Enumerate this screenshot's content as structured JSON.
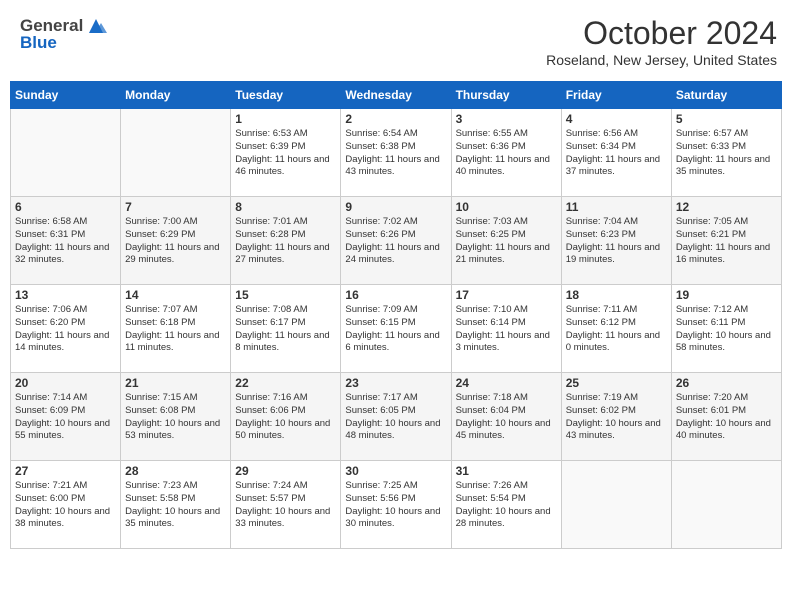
{
  "header": {
    "logo_general": "General",
    "logo_blue": "Blue",
    "month": "October 2024",
    "location": "Roseland, New Jersey, United States"
  },
  "days_of_week": [
    "Sunday",
    "Monday",
    "Tuesday",
    "Wednesday",
    "Thursday",
    "Friday",
    "Saturday"
  ],
  "weeks": [
    [
      {
        "day": "",
        "sunrise": "",
        "sunset": "",
        "daylight": ""
      },
      {
        "day": "",
        "sunrise": "",
        "sunset": "",
        "daylight": ""
      },
      {
        "day": "1",
        "sunrise": "Sunrise: 6:53 AM",
        "sunset": "Sunset: 6:39 PM",
        "daylight": "Daylight: 11 hours and 46 minutes."
      },
      {
        "day": "2",
        "sunrise": "Sunrise: 6:54 AM",
        "sunset": "Sunset: 6:38 PM",
        "daylight": "Daylight: 11 hours and 43 minutes."
      },
      {
        "day": "3",
        "sunrise": "Sunrise: 6:55 AM",
        "sunset": "Sunset: 6:36 PM",
        "daylight": "Daylight: 11 hours and 40 minutes."
      },
      {
        "day": "4",
        "sunrise": "Sunrise: 6:56 AM",
        "sunset": "Sunset: 6:34 PM",
        "daylight": "Daylight: 11 hours and 37 minutes."
      },
      {
        "day": "5",
        "sunrise": "Sunrise: 6:57 AM",
        "sunset": "Sunset: 6:33 PM",
        "daylight": "Daylight: 11 hours and 35 minutes."
      }
    ],
    [
      {
        "day": "6",
        "sunrise": "Sunrise: 6:58 AM",
        "sunset": "Sunset: 6:31 PM",
        "daylight": "Daylight: 11 hours and 32 minutes."
      },
      {
        "day": "7",
        "sunrise": "Sunrise: 7:00 AM",
        "sunset": "Sunset: 6:29 PM",
        "daylight": "Daylight: 11 hours and 29 minutes."
      },
      {
        "day": "8",
        "sunrise": "Sunrise: 7:01 AM",
        "sunset": "Sunset: 6:28 PM",
        "daylight": "Daylight: 11 hours and 27 minutes."
      },
      {
        "day": "9",
        "sunrise": "Sunrise: 7:02 AM",
        "sunset": "Sunset: 6:26 PM",
        "daylight": "Daylight: 11 hours and 24 minutes."
      },
      {
        "day": "10",
        "sunrise": "Sunrise: 7:03 AM",
        "sunset": "Sunset: 6:25 PM",
        "daylight": "Daylight: 11 hours and 21 minutes."
      },
      {
        "day": "11",
        "sunrise": "Sunrise: 7:04 AM",
        "sunset": "Sunset: 6:23 PM",
        "daylight": "Daylight: 11 hours and 19 minutes."
      },
      {
        "day": "12",
        "sunrise": "Sunrise: 7:05 AM",
        "sunset": "Sunset: 6:21 PM",
        "daylight": "Daylight: 11 hours and 16 minutes."
      }
    ],
    [
      {
        "day": "13",
        "sunrise": "Sunrise: 7:06 AM",
        "sunset": "Sunset: 6:20 PM",
        "daylight": "Daylight: 11 hours and 14 minutes."
      },
      {
        "day": "14",
        "sunrise": "Sunrise: 7:07 AM",
        "sunset": "Sunset: 6:18 PM",
        "daylight": "Daylight: 11 hours and 11 minutes."
      },
      {
        "day": "15",
        "sunrise": "Sunrise: 7:08 AM",
        "sunset": "Sunset: 6:17 PM",
        "daylight": "Daylight: 11 hours and 8 minutes."
      },
      {
        "day": "16",
        "sunrise": "Sunrise: 7:09 AM",
        "sunset": "Sunset: 6:15 PM",
        "daylight": "Daylight: 11 hours and 6 minutes."
      },
      {
        "day": "17",
        "sunrise": "Sunrise: 7:10 AM",
        "sunset": "Sunset: 6:14 PM",
        "daylight": "Daylight: 11 hours and 3 minutes."
      },
      {
        "day": "18",
        "sunrise": "Sunrise: 7:11 AM",
        "sunset": "Sunset: 6:12 PM",
        "daylight": "Daylight: 11 hours and 0 minutes."
      },
      {
        "day": "19",
        "sunrise": "Sunrise: 7:12 AM",
        "sunset": "Sunset: 6:11 PM",
        "daylight": "Daylight: 10 hours and 58 minutes."
      }
    ],
    [
      {
        "day": "20",
        "sunrise": "Sunrise: 7:14 AM",
        "sunset": "Sunset: 6:09 PM",
        "daylight": "Daylight: 10 hours and 55 minutes."
      },
      {
        "day": "21",
        "sunrise": "Sunrise: 7:15 AM",
        "sunset": "Sunset: 6:08 PM",
        "daylight": "Daylight: 10 hours and 53 minutes."
      },
      {
        "day": "22",
        "sunrise": "Sunrise: 7:16 AM",
        "sunset": "Sunset: 6:06 PM",
        "daylight": "Daylight: 10 hours and 50 minutes."
      },
      {
        "day": "23",
        "sunrise": "Sunrise: 7:17 AM",
        "sunset": "Sunset: 6:05 PM",
        "daylight": "Daylight: 10 hours and 48 minutes."
      },
      {
        "day": "24",
        "sunrise": "Sunrise: 7:18 AM",
        "sunset": "Sunset: 6:04 PM",
        "daylight": "Daylight: 10 hours and 45 minutes."
      },
      {
        "day": "25",
        "sunrise": "Sunrise: 7:19 AM",
        "sunset": "Sunset: 6:02 PM",
        "daylight": "Daylight: 10 hours and 43 minutes."
      },
      {
        "day": "26",
        "sunrise": "Sunrise: 7:20 AM",
        "sunset": "Sunset: 6:01 PM",
        "daylight": "Daylight: 10 hours and 40 minutes."
      }
    ],
    [
      {
        "day": "27",
        "sunrise": "Sunrise: 7:21 AM",
        "sunset": "Sunset: 6:00 PM",
        "daylight": "Daylight: 10 hours and 38 minutes."
      },
      {
        "day": "28",
        "sunrise": "Sunrise: 7:23 AM",
        "sunset": "Sunset: 5:58 PM",
        "daylight": "Daylight: 10 hours and 35 minutes."
      },
      {
        "day": "29",
        "sunrise": "Sunrise: 7:24 AM",
        "sunset": "Sunset: 5:57 PM",
        "daylight": "Daylight: 10 hours and 33 minutes."
      },
      {
        "day": "30",
        "sunrise": "Sunrise: 7:25 AM",
        "sunset": "Sunset: 5:56 PM",
        "daylight": "Daylight: 10 hours and 30 minutes."
      },
      {
        "day": "31",
        "sunrise": "Sunrise: 7:26 AM",
        "sunset": "Sunset: 5:54 PM",
        "daylight": "Daylight: 10 hours and 28 minutes."
      },
      {
        "day": "",
        "sunrise": "",
        "sunset": "",
        "daylight": ""
      },
      {
        "day": "",
        "sunrise": "",
        "sunset": "",
        "daylight": ""
      }
    ]
  ]
}
